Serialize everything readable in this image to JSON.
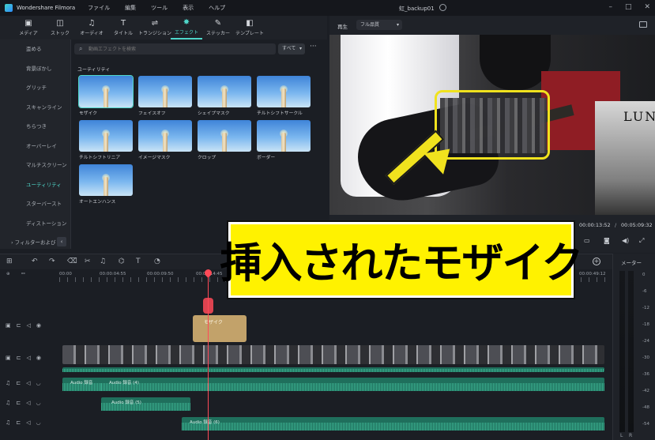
{
  "app": {
    "name": "Wondershare Filmora",
    "menu": [
      "ファイル",
      "編集",
      "ツール",
      "表示",
      "ヘルプ"
    ],
    "project_title": "虹_backup01"
  },
  "toolbar": {
    "tabs": [
      {
        "label": "メディア",
        "icon": "media-icon",
        "glyph": "▣"
      },
      {
        "label": "ストック",
        "icon": "stock-icon",
        "glyph": "◫"
      },
      {
        "label": "オーディオ",
        "icon": "music-note-icon",
        "glyph": "♫"
      },
      {
        "label": "タイトル",
        "icon": "title-icon",
        "glyph": "T"
      },
      {
        "label": "トランジション",
        "icon": "transition-icon",
        "glyph": "⇌"
      },
      {
        "label": "エフェクト",
        "icon": "effect-icon",
        "glyph": "✸"
      },
      {
        "label": "ステッカー",
        "icon": "sticker-icon",
        "glyph": "✎"
      },
      {
        "label": "テンプレート",
        "icon": "template-icon",
        "glyph": "◧"
      }
    ],
    "active_tab": "エフェクト"
  },
  "categories": {
    "items": [
      "歪める",
      "背景ぼかし",
      "グリッチ",
      "スキャンライン",
      "ちらつき",
      "オーバーレイ",
      "マルチスクリーン",
      "ユーティリティ",
      "スターバースト",
      "ディストーション"
    ],
    "active": "ユーティリティ",
    "folder": "フィルターおよび"
  },
  "effects": {
    "search_placeholder": "動画エフェクトを検索",
    "filter_label": "すべて",
    "section_title": "ユーティリティ",
    "items": [
      "モザイク",
      "フェイスオフ",
      "シェイプマスク",
      "チルトシフトサークル",
      "チルトシフトリニア",
      "イメージマスク",
      "クロップ",
      "ボーダー",
      "オートエンハンス"
    ],
    "selected": "モザイク"
  },
  "preview": {
    "play_label": "再生",
    "quality": "フル品質",
    "poster_text": "LUNA",
    "current_time": "00:00:13:52",
    "separator": "/",
    "total_time": "00:05:09:32"
  },
  "timeline": {
    "ruler_times": [
      "00:00",
      "00:00:04:55",
      "00:00:09:50",
      "00:00:14:45",
      "00:00:49:12"
    ],
    "fx_clip_label": "モザイク",
    "audio_clips": [
      {
        "label": "Audio 録音"
      },
      {
        "label": "Audio 録音 (4)"
      },
      {
        "label": "Audio 録音 (5)"
      },
      {
        "label": "Audio 録音 (6)"
      }
    ]
  },
  "caption": {
    "text": "挿入されたモザイク"
  },
  "meter": {
    "title": "メーター",
    "scale": [
      "0",
      "-6",
      "-12",
      "-18",
      "-24",
      "-30",
      "-36",
      "-42",
      "-48",
      "-54"
    ],
    "channels": [
      "L",
      "R"
    ]
  },
  "colors": {
    "accent": "#4fd6c9",
    "playhead": "#ff4a58",
    "caption_bg": "#fff200",
    "highlight_frame": "#f0e21e"
  }
}
